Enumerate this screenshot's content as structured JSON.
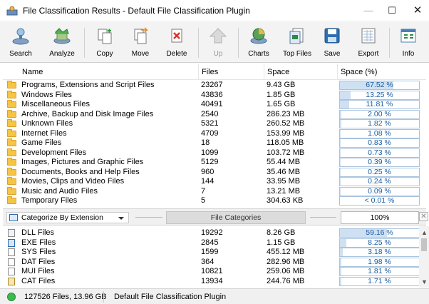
{
  "window": {
    "title": "File Classification Results - Default File Classification Plugin"
  },
  "toolbar": [
    {
      "label": "Search",
      "icon": "search-icon",
      "disabled": false
    },
    {
      "label": "Analyze",
      "icon": "analyze-icon",
      "disabled": false
    },
    {
      "label": "Copy",
      "icon": "copy-icon",
      "disabled": false
    },
    {
      "label": "Move",
      "icon": "move-icon",
      "disabled": false
    },
    {
      "label": "Delete",
      "icon": "delete-icon",
      "disabled": false
    },
    {
      "label": "Up",
      "icon": "up-arrow-icon",
      "disabled": true
    },
    {
      "label": "Charts",
      "icon": "charts-icon",
      "disabled": false
    },
    {
      "label": "Top Files",
      "icon": "top-files-icon",
      "disabled": false
    },
    {
      "label": "Save",
      "icon": "save-icon",
      "disabled": false
    },
    {
      "label": "Export",
      "icon": "export-icon",
      "disabled": false
    },
    {
      "label": "Info",
      "icon": "info-icon",
      "disabled": false
    }
  ],
  "table": {
    "columns": [
      "Name",
      "Files",
      "Space",
      "Space (%)"
    ],
    "rows": [
      {
        "name": "Programs, Extensions and Script Files",
        "files": "23267",
        "space": "9.43 GB",
        "pct": "67.52 %",
        "pct_value": 67.52
      },
      {
        "name": "Windows Files",
        "files": "43836",
        "space": "1.85 GB",
        "pct": "13.25 %",
        "pct_value": 13.25
      },
      {
        "name": "Miscellaneous Files",
        "files": "40491",
        "space": "1.65 GB",
        "pct": "11.81 %",
        "pct_value": 11.81
      },
      {
        "name": "Archive, Backup and Disk Image Files",
        "files": "2540",
        "space": "286.23 MB",
        "pct": "2.00 %",
        "pct_value": 2.0
      },
      {
        "name": "Unknown Files",
        "files": "5321",
        "space": "260.52 MB",
        "pct": "1.82 %",
        "pct_value": 1.82
      },
      {
        "name": "Internet Files",
        "files": "4709",
        "space": "153.99 MB",
        "pct": "1.08 %",
        "pct_value": 1.08
      },
      {
        "name": "Game Files",
        "files": "18",
        "space": "118.05 MB",
        "pct": "0.83 %",
        "pct_value": 0.83
      },
      {
        "name": "Development Files",
        "files": "1099",
        "space": "103.72 MB",
        "pct": "0.73 %",
        "pct_value": 0.73
      },
      {
        "name": "Images, Pictures and Graphic Files",
        "files": "5129",
        "space": "55.44 MB",
        "pct": "0.39 %",
        "pct_value": 0.39
      },
      {
        "name": "Documents, Books and Help Files",
        "files": "960",
        "space": "35.46 MB",
        "pct": "0.25 %",
        "pct_value": 0.25
      },
      {
        "name": "Movies, Clips and Video Files",
        "files": "144",
        "space": "33.95 MB",
        "pct": "0.24 %",
        "pct_value": 0.24
      },
      {
        "name": "Music and Audio Files",
        "files": "7",
        "space": "13.21 MB",
        "pct": "0.09 %",
        "pct_value": 0.09
      },
      {
        "name": "Temporary Files",
        "files": "5",
        "space": "304.63 KB",
        "pct": "< 0.01 %",
        "pct_value": 0.0
      }
    ]
  },
  "midbar": {
    "select_value": "Categorize By Extension",
    "section_label": "File Categories",
    "total_pct": "100%"
  },
  "lower": {
    "rows": [
      {
        "name": "DLL Files",
        "files": "19292",
        "space": "8.26 GB",
        "pct": "59.16 %",
        "pct_value": 59.16,
        "icon": "dll-file-icon"
      },
      {
        "name": "EXE Files",
        "files": "2845",
        "space": "1.15 GB",
        "pct": "8.25 %",
        "pct_value": 8.25,
        "icon": "exe-file-icon"
      },
      {
        "name": "SYS Files",
        "files": "1599",
        "space": "455.12 MB",
        "pct": "3.18 %",
        "pct_value": 3.18,
        "icon": "sys-file-icon"
      },
      {
        "name": "DAT Files",
        "files": "364",
        "space": "282.96 MB",
        "pct": "1.98 %",
        "pct_value": 1.98,
        "icon": "dat-file-icon"
      },
      {
        "name": "MUI Files",
        "files": "10821",
        "space": "259.06 MB",
        "pct": "1.81 %",
        "pct_value": 1.81,
        "icon": "mui-file-icon"
      },
      {
        "name": "CAT Files",
        "files": "13934",
        "space": "244.76 MB",
        "pct": "1.71 %",
        "pct_value": 1.71,
        "icon": "cat-file-icon"
      }
    ]
  },
  "status": {
    "summary": "127526 Files, 13.96 GB",
    "plugin": "Default File Classification Plugin"
  },
  "colors": {
    "bar_fill": "#cfe0f2",
    "bar_border": "#a9c4de",
    "pct_text": "#1d5fa3",
    "status_ok": "#3dba4e"
  }
}
